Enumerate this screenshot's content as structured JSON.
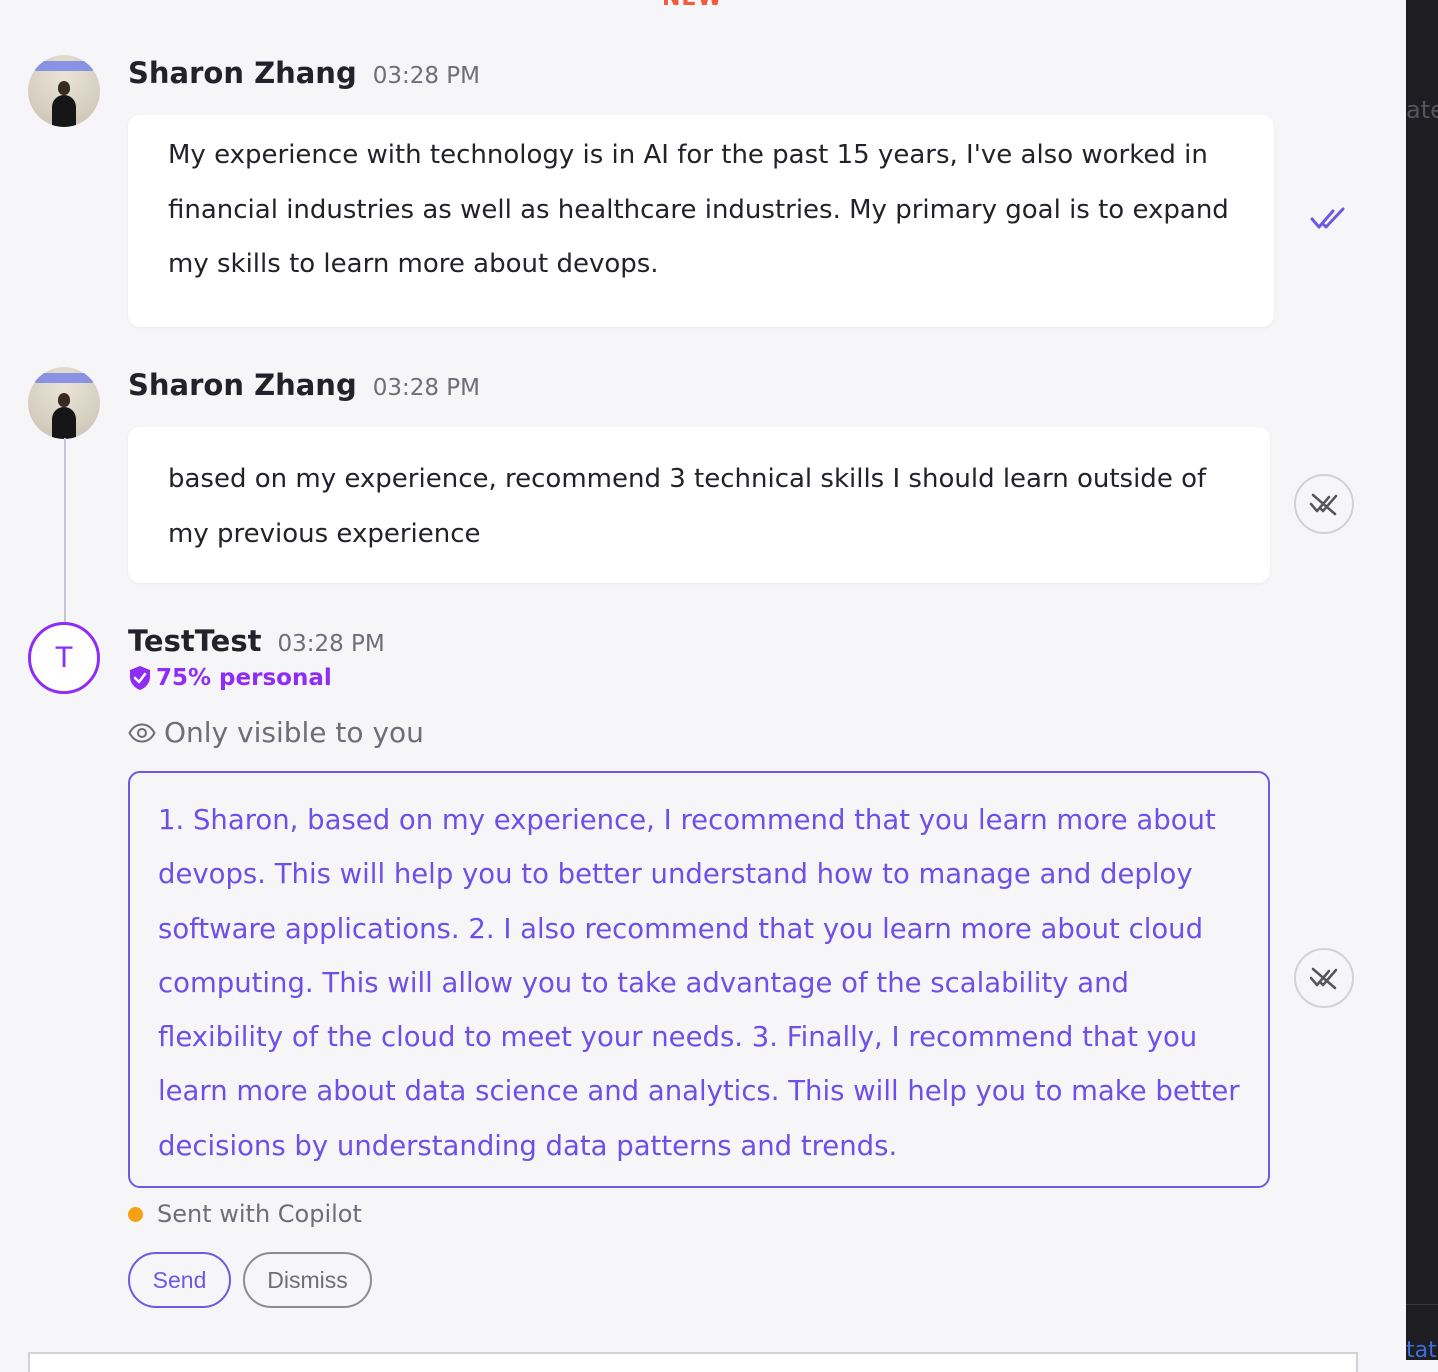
{
  "new_divider_label": "NEW",
  "messages": [
    {
      "author": "Sharon Zhang",
      "time": "03:28 PM",
      "text": "My experience with technology is in AI for the past 15 years, I've also worked in financial industries as well as healthcare industries. My primary goal is to expand my skills to learn more about devops."
    },
    {
      "author": "Sharon Zhang",
      "time": "03:28 PM",
      "text": "based on my experience, recommend 3 technical skills I should learn outside of my previous experience"
    }
  ],
  "reply": {
    "avatar_letter": "T",
    "author": "TestTest",
    "time": "03:28 PM",
    "personal_badge": "75% personal",
    "visibility_label": "Only visible to you",
    "text": "1. Sharon, based on my experience, I recommend that you learn more about devops. This will help you to better understand how to manage and deploy software applications. 2. I also recommend that you learn more about cloud computing. This will allow you to take advantage of the scalability and flexibility of the cloud to meet your needs. 3. Finally, I recommend that you learn more about data science and analytics. This will help you to make better decisions by understanding data patterns and trends.",
    "sent_with_label": "Sent with Copilot",
    "send_label": "Send",
    "dismiss_label": "Dismiss"
  },
  "right_panel": {
    "top_peek": "ate",
    "bottom_peek": "tati"
  },
  "icons": {
    "read_receipt": "double-check-icon",
    "not_delivered": "not-delivered-icon",
    "badge": "shield-check-icon",
    "visibility": "eye-icon"
  },
  "colors": {
    "accent_purple": "#8f2cf5",
    "copilot_text": "#6e4fe7",
    "new_label": "#f2593f",
    "copilot_dot": "#f5a113"
  }
}
